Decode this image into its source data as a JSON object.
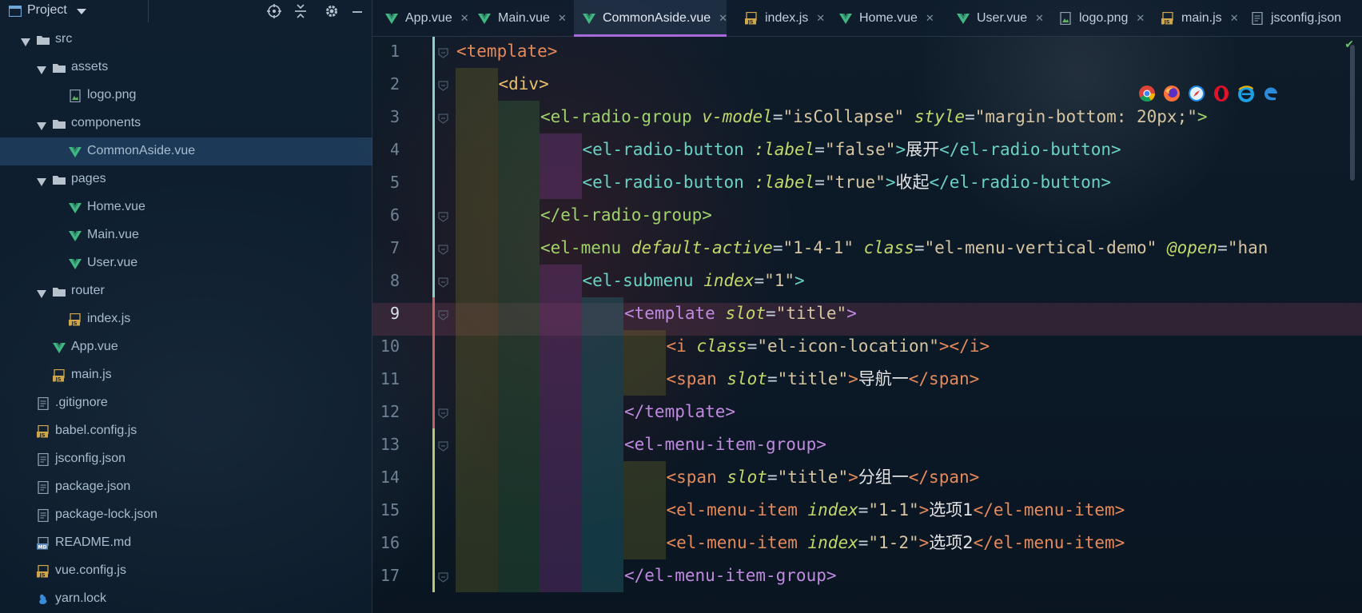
{
  "project_panel": {
    "title": "Project",
    "tree": [
      {
        "label": "src",
        "type": "folder",
        "depth": 0,
        "expanded": true
      },
      {
        "label": "assets",
        "type": "folder",
        "depth": 1,
        "expanded": true
      },
      {
        "label": "logo.png",
        "type": "image",
        "depth": 2
      },
      {
        "label": "components",
        "type": "folder",
        "depth": 1,
        "expanded": true
      },
      {
        "label": "CommonAside.vue",
        "type": "vue",
        "depth": 2,
        "selected": true
      },
      {
        "label": "pages",
        "type": "folder",
        "depth": 1,
        "expanded": true
      },
      {
        "label": "Home.vue",
        "type": "vue",
        "depth": 2
      },
      {
        "label": "Main.vue",
        "type": "vue",
        "depth": 2
      },
      {
        "label": "User.vue",
        "type": "vue",
        "depth": 2
      },
      {
        "label": "router",
        "type": "folder",
        "depth": 1,
        "expanded": true
      },
      {
        "label": "index.js",
        "type": "js",
        "depth": 2
      },
      {
        "label": "App.vue",
        "type": "vue",
        "depth": 1
      },
      {
        "label": "main.js",
        "type": "js",
        "depth": 1
      },
      {
        "label": ".gitignore",
        "type": "config",
        "depth": 0
      },
      {
        "label": "babel.config.js",
        "type": "js",
        "depth": 0
      },
      {
        "label": "jsconfig.json",
        "type": "config",
        "depth": 0
      },
      {
        "label": "package.json",
        "type": "config",
        "depth": 0
      },
      {
        "label": "package-lock.json",
        "type": "config",
        "depth": 0
      },
      {
        "label": "README.md",
        "type": "md",
        "depth": 0
      },
      {
        "label": "vue.config.js",
        "type": "js",
        "depth": 0
      },
      {
        "label": "yarn.lock",
        "type": "yarn",
        "depth": 0
      }
    ]
  },
  "tabs": [
    {
      "label": "App.vue",
      "type": "vue"
    },
    {
      "label": "Main.vue",
      "type": "vue"
    },
    {
      "label": "CommonAside.vue",
      "type": "vue",
      "active": true
    },
    {
      "label": "index.js",
      "type": "js"
    },
    {
      "label": "Home.vue",
      "type": "vue"
    },
    {
      "label": "User.vue",
      "type": "vue"
    },
    {
      "label": "logo.png",
      "type": "image"
    },
    {
      "label": "main.js",
      "type": "js"
    },
    {
      "label": "jsconfig.json",
      "type": "config"
    }
  ],
  "editor": {
    "current_line": 9,
    "lines": [
      {
        "n": "1",
        "indent": 0,
        "tokens": [
          [
            "t-tag5",
            "<template>"
          ]
        ]
      },
      {
        "n": "2",
        "indent": 1,
        "tokens": [
          [
            "t-tag",
            "<div>"
          ]
        ]
      },
      {
        "n": "3",
        "indent": 2,
        "tokens": [
          [
            "t-tag2",
            "<el-radio-group "
          ],
          [
            "t-attr",
            "v-model"
          ],
          [
            "t-eq",
            "="
          ],
          [
            "t-str",
            "\"isCollapse\" "
          ],
          [
            "t-attr",
            "style"
          ],
          [
            "t-eq",
            "="
          ],
          [
            "t-str",
            "\"margin-bottom: 20px;\""
          ],
          [
            "t-tag2",
            ">"
          ]
        ]
      },
      {
        "n": "4",
        "indent": 3,
        "tokens": [
          [
            "t-tag3",
            "<el-radio-button "
          ],
          [
            "t-attr",
            ":label"
          ],
          [
            "t-eq",
            "="
          ],
          [
            "t-str",
            "\"false\""
          ],
          [
            "t-tag3",
            ">"
          ],
          [
            "t-text",
            "展开"
          ],
          [
            "t-tag3",
            "</el-radio-button>"
          ]
        ]
      },
      {
        "n": "5",
        "indent": 3,
        "tokens": [
          [
            "t-tag3",
            "<el-radio-button "
          ],
          [
            "t-attr",
            ":label"
          ],
          [
            "t-eq",
            "="
          ],
          [
            "t-str",
            "\"true\""
          ],
          [
            "t-tag3",
            ">"
          ],
          [
            "t-text",
            "收起"
          ],
          [
            "t-tag3",
            "</el-radio-button>"
          ]
        ]
      },
      {
        "n": "6",
        "indent": 2,
        "tokens": [
          [
            "t-tag2",
            "</el-radio-group>"
          ]
        ]
      },
      {
        "n": "7",
        "indent": 2,
        "tokens": [
          [
            "t-tag2",
            "<el-menu "
          ],
          [
            "t-attr",
            "default-active"
          ],
          [
            "t-eq",
            "="
          ],
          [
            "t-str",
            "\"1-4-1\" "
          ],
          [
            "t-attr",
            "class"
          ],
          [
            "t-eq",
            "="
          ],
          [
            "t-str",
            "\"el-menu-vertical-demo\" "
          ],
          [
            "t-attr",
            "@open"
          ],
          [
            "t-eq",
            "="
          ],
          [
            "t-str",
            "\"han"
          ]
        ]
      },
      {
        "n": "8",
        "indent": 3,
        "tokens": [
          [
            "t-tag3",
            "<el-submenu "
          ],
          [
            "t-attr",
            "index"
          ],
          [
            "t-eq",
            "="
          ],
          [
            "t-str",
            "\"1\""
          ],
          [
            "t-tag3",
            ">"
          ]
        ]
      },
      {
        "n": "9",
        "indent": 4,
        "tokens": [
          [
            "t-tag4",
            "<template "
          ],
          [
            "t-attr",
            "slot"
          ],
          [
            "t-eq",
            "="
          ],
          [
            "t-str",
            "\"title\""
          ],
          [
            "t-tag4",
            ">"
          ]
        ]
      },
      {
        "n": "10",
        "indent": 5,
        "tokens": [
          [
            "t-tag5",
            "<i "
          ],
          [
            "t-attr",
            "class"
          ],
          [
            "t-eq",
            "="
          ],
          [
            "t-str",
            "\"el-icon-location\""
          ],
          [
            "t-tag5",
            "></i>"
          ]
        ]
      },
      {
        "n": "11",
        "indent": 5,
        "tokens": [
          [
            "t-tag5",
            "<span "
          ],
          [
            "t-attr",
            "slot"
          ],
          [
            "t-eq",
            "="
          ],
          [
            "t-str",
            "\"title\""
          ],
          [
            "t-tag5",
            ">"
          ],
          [
            "t-text",
            "导航一"
          ],
          [
            "t-tag5",
            "</span>"
          ]
        ]
      },
      {
        "n": "12",
        "indent": 4,
        "tokens": [
          [
            "t-tag4",
            "</template>"
          ]
        ]
      },
      {
        "n": "13",
        "indent": 4,
        "tokens": [
          [
            "t-tag4",
            "<el-menu-item-group>"
          ]
        ]
      },
      {
        "n": "14",
        "indent": 5,
        "tokens": [
          [
            "t-tag5",
            "<span "
          ],
          [
            "t-attr",
            "slot"
          ],
          [
            "t-eq",
            "="
          ],
          [
            "t-str",
            "\"title\""
          ],
          [
            "t-tag5",
            ">"
          ],
          [
            "t-text",
            "分组一"
          ],
          [
            "t-tag5",
            "</span>"
          ]
        ]
      },
      {
        "n": "15",
        "indent": 5,
        "tokens": [
          [
            "t-tag5",
            "<el-menu-item "
          ],
          [
            "t-attr",
            "index"
          ],
          [
            "t-eq",
            "="
          ],
          [
            "t-str",
            "\"1-1\""
          ],
          [
            "t-tag5",
            ">"
          ],
          [
            "t-text",
            "选项1"
          ],
          [
            "t-tag5",
            "</el-menu-item>"
          ]
        ]
      },
      {
        "n": "16",
        "indent": 5,
        "tokens": [
          [
            "t-tag5",
            "<el-menu-item "
          ],
          [
            "t-attr",
            "index"
          ],
          [
            "t-eq",
            "="
          ],
          [
            "t-str",
            "\"1-2\""
          ],
          [
            "t-tag5",
            ">"
          ],
          [
            "t-text",
            "选项2"
          ],
          [
            "t-tag5",
            "</el-menu-item>"
          ]
        ]
      },
      {
        "n": "17",
        "indent": 4,
        "tokens": [
          [
            "t-tag4",
            "</el-menu-item-group>"
          ]
        ]
      }
    ]
  },
  "icons": {
    "project": "project-window-icon",
    "locate": "locate-icon",
    "collapse": "collapse-all-icon",
    "settings": "gear-icon",
    "minimize": "minimize-icon",
    "browsers": [
      "chrome-icon",
      "firefox-icon",
      "safari-icon",
      "opera-icon",
      "ie-icon",
      "edge-icon"
    ]
  },
  "colors": {
    "accent": "#a86ad9",
    "vue": "#41b883",
    "selected_row": "#284f78"
  }
}
